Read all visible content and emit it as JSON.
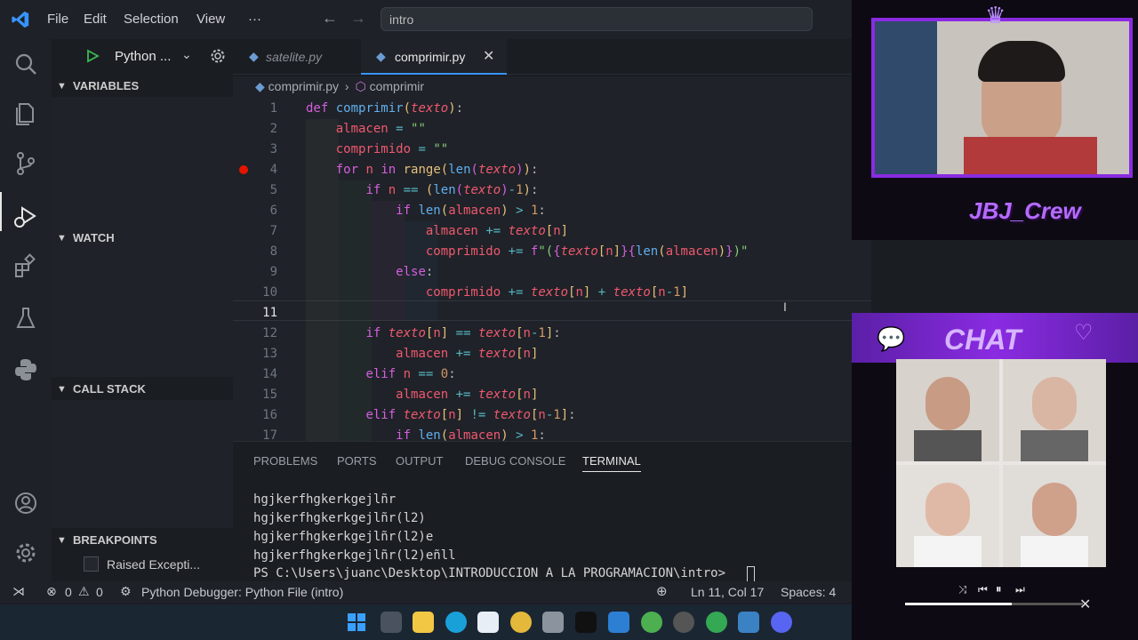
{
  "titlebar": {
    "menu": [
      "File",
      "Edit",
      "Selection",
      "View",
      "···"
    ],
    "search": "intro"
  },
  "activitybar": {
    "icons": [
      "explorer-icon",
      "files-icon",
      "source-control-icon",
      "run-debug-icon",
      "extensions-icon",
      "testing-icon",
      "python-icon",
      "account-icon",
      "settings-gear-icon"
    ]
  },
  "debug_toolbar": {
    "config_label": "Python ..."
  },
  "sidebar": {
    "variables": "VARIABLES",
    "watch": "WATCH",
    "call_stack": "CALL STACK",
    "breakpoints": "BREAKPOINTS",
    "breakpoint_item": "Raised Excepti..."
  },
  "tabs": [
    {
      "label": "satelite.py",
      "active": false
    },
    {
      "label": "comprimir.py",
      "active": true
    }
  ],
  "breadcrumb": {
    "file": "comprimir.py",
    "symbol": "comprimir"
  },
  "code": {
    "line_numbers": [
      "1",
      "2",
      "3",
      "4",
      "5",
      "6",
      "7",
      "8",
      "9",
      "10",
      "11",
      "12",
      "13",
      "14",
      "15",
      "16",
      "17"
    ],
    "active_line": 11,
    "breakpoint_line": 4
  },
  "panel": {
    "tabs": [
      "PROBLEMS",
      "PORTS",
      "OUTPUT",
      "DEBUG CONSOLE",
      "TERMINAL"
    ],
    "active_tab": "TERMINAL",
    "terminal_lines": [
      "hgjkerfhgkerkgejlñr",
      "hgjkerfhgkerkgejlñr(l2)",
      "hgjkerfhgkerkgejlñr(l2)e",
      "hgjkerfhgkerkgejlñr(l2)eñll",
      "PS C:\\Users\\juanc\\Desktop\\INTRODUCCION A LA PROGRAMACION\\intro> "
    ]
  },
  "statusbar": {
    "errors": "0",
    "warnings": "0",
    "debugger": "Python Debugger: Python File (intro)",
    "position": "Ln 11, Col 17",
    "spaces": "Spaces: 4"
  },
  "overlay": {
    "crew_label": "JBJ_Crew",
    "chat_label": "CHAT"
  },
  "colors": {
    "accent": "#3794ff",
    "overlay_purple": "#8a2be2",
    "breakpoint": "#e51400"
  }
}
